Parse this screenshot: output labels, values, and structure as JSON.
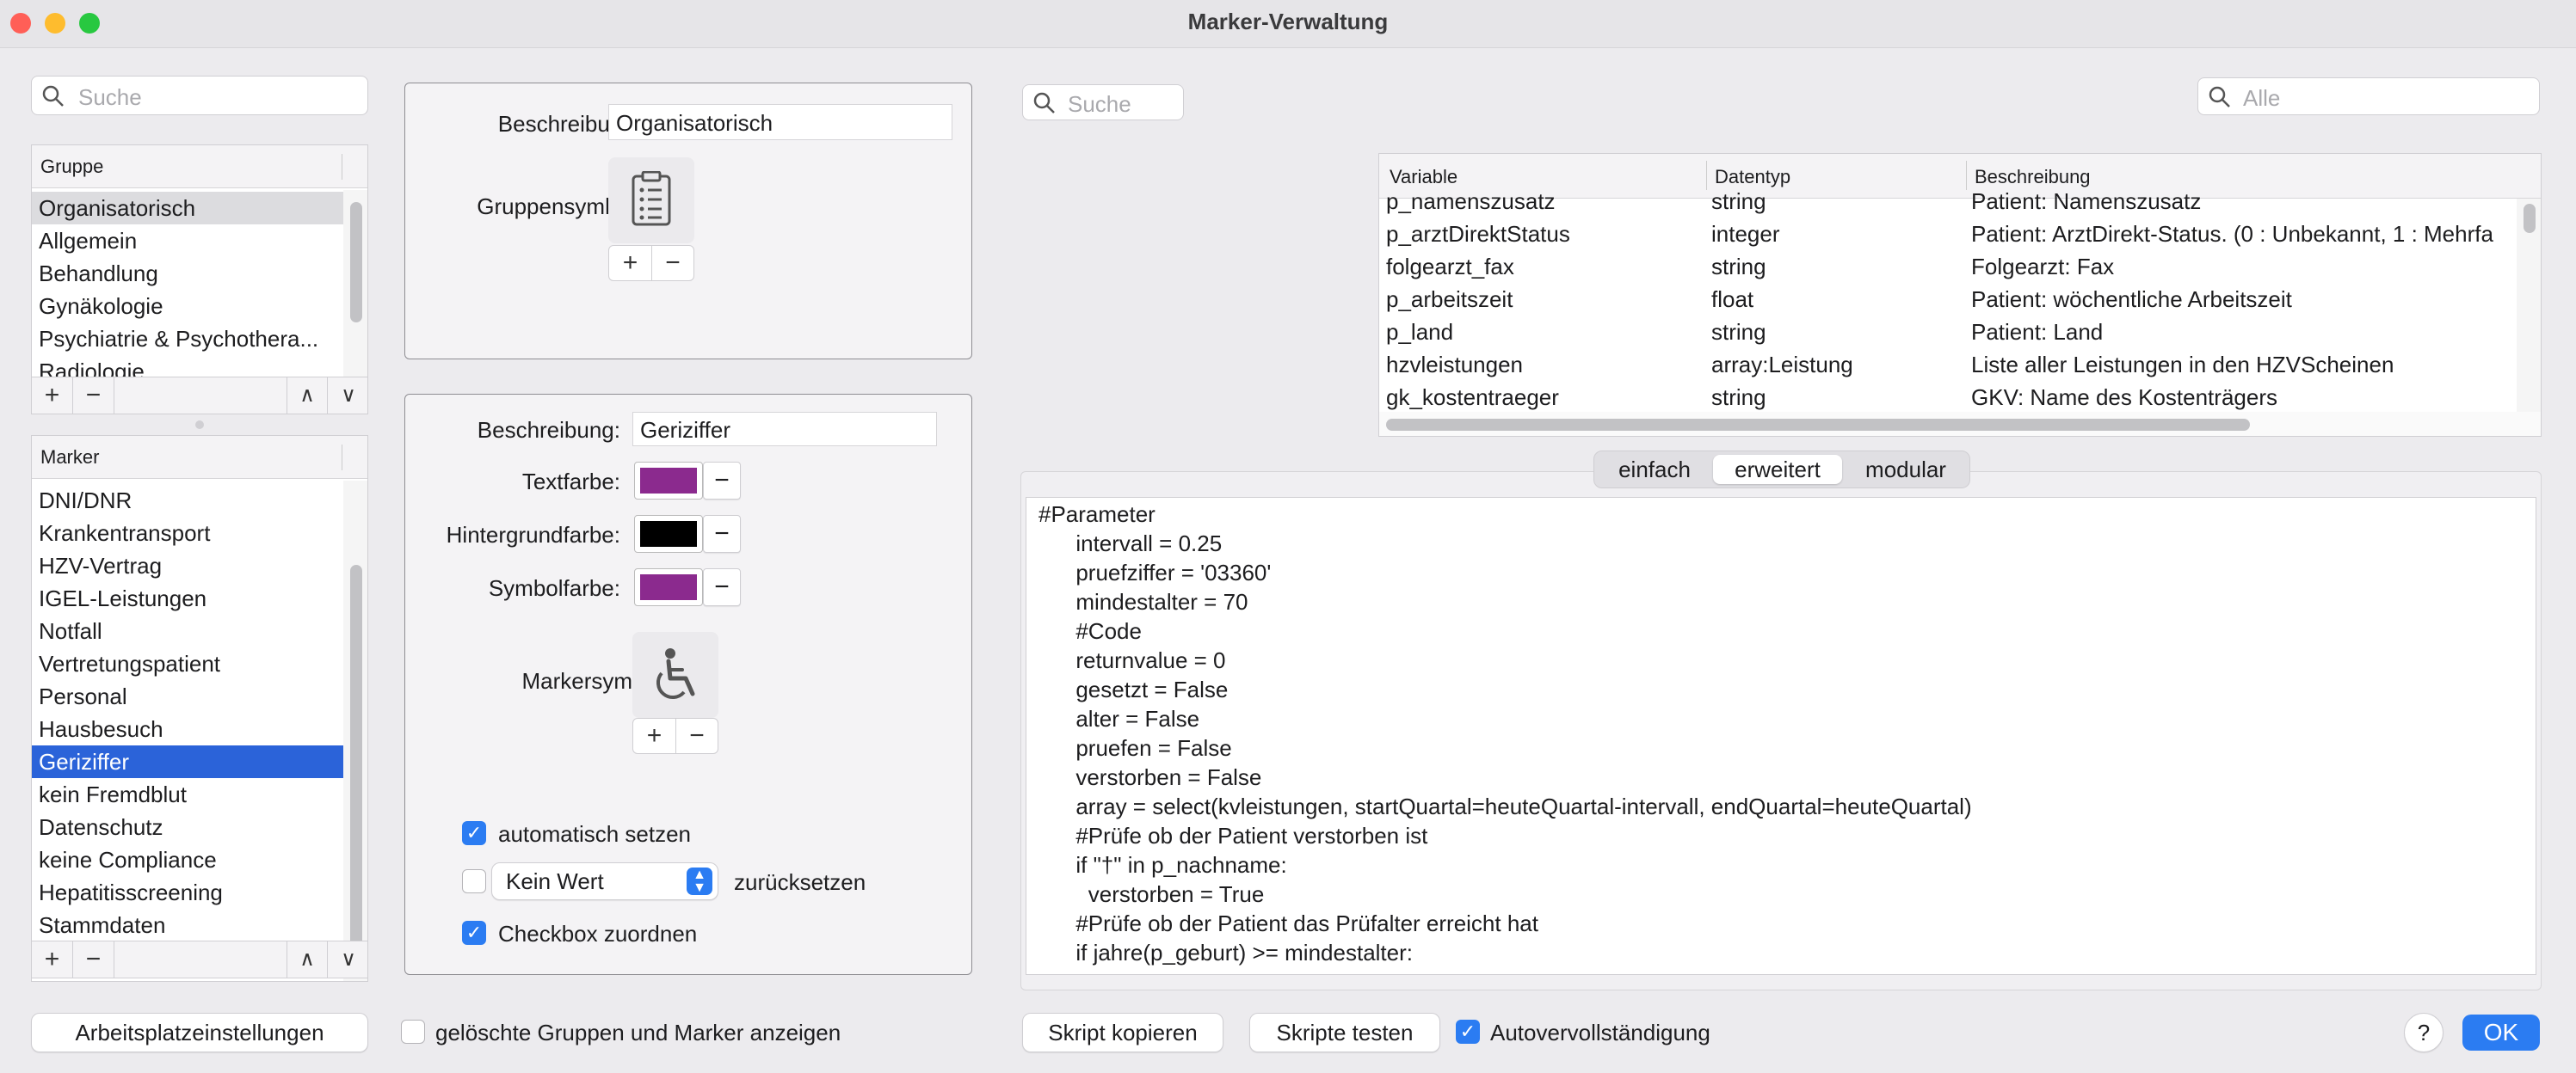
{
  "window": {
    "title": "Marker-Verwaltung"
  },
  "colors": {
    "accent": "#2b7cf2",
    "selection": "#2b63d9",
    "purple": "#8b2a8e",
    "black": "#000000"
  },
  "left": {
    "search_placeholder": "Suche",
    "groups_header": "Gruppe",
    "groups": [
      "Organisatorisch",
      "Allgemein",
      "Behandlung",
      "Gynäkologie",
      "Psychiatrie & Psychothera...",
      "Radiologie"
    ],
    "marker_header": "Marker",
    "markers": [
      "DNI/DNR",
      "Krankentransport",
      "HZV-Vertrag",
      "IGEL-Leistungen",
      "Notfall",
      "Vertretungspatient",
      "Personal",
      "Hausbesuch",
      "Geriziffer",
      "kein Fremdblut",
      "Datenschutz",
      "keine Compliance",
      "Hepatitisscreening",
      "Stammdaten"
    ],
    "selected_marker": "Geriziffer"
  },
  "group_panel": {
    "desc_label": "Beschreibung:",
    "desc_value": "Organisatorisch",
    "symbol_label": "Gruppensymbol:",
    "symbol_icon": "clipboard-list-icon"
  },
  "marker_panel": {
    "desc_label": "Beschreibung:",
    "desc_value": "Geriziffer",
    "textcolor_label": "Textfarbe:",
    "bgcolor_label": "Hintergrundfarbe:",
    "symbolcolor_label": "Symbolfarbe:",
    "markersymbol_label": "Markersymbol:",
    "symbol_icon": "wheelchair-icon",
    "auto_set_label": "automatisch setzen",
    "reset_select_value": "Kein Wert",
    "reset_label": "zurücksetzen",
    "checkbox_assign_label": "Checkbox zuordnen"
  },
  "right": {
    "search_placeholder": "Suche",
    "filter_placeholder": "Alle",
    "columns": [
      "Variable",
      "Datentyp",
      "Beschreibung"
    ],
    "rows": [
      [
        "p_namenszusatz",
        "string",
        "Patient: Namenszusatz"
      ],
      [
        "p_arztDirektStatus",
        "integer",
        "Patient: ArztDirekt-Status. (0 : Unbekannt, 1 : Mehrfa"
      ],
      [
        "folgearzt_fax",
        "string",
        "Folgearzt: Fax"
      ],
      [
        "p_arbeitszeit",
        "float",
        "Patient: wöchentliche Arbeitszeit"
      ],
      [
        "p_land",
        "string",
        "Patient: Land"
      ],
      [
        "hzvleistungen",
        "array:Leistung",
        "Liste aller Leistungen in den HZVScheinen"
      ],
      [
        "gk_kostentraeger",
        "string",
        "GKV: Name des Kostenträgers"
      ]
    ],
    "tabs": [
      "einfach",
      "erweitert",
      "modular"
    ],
    "active_tab": "erweitert",
    "code": [
      "#Parameter",
      "      intervall = 0.25",
      "      pruefziffer = '03360'",
      "      mindestalter = 70",
      "      #Code",
      "      returnvalue = 0",
      "      gesetzt = False",
      "      alter = False",
      "      pruefen = False",
      "      verstorben = False",
      "      array = select(kvleistungen, startQuartal=heuteQuartal-intervall, endQuartal=heuteQuartal)",
      "      #Prüfe ob der Patient verstorben ist",
      "      if \"†\" in p_nachname:",
      "        verstorben = True",
      "      #Prüfe ob der Patient das Prüfalter erreicht hat",
      "      if jahre(p_geburt) >= mindestalter:"
    ]
  },
  "footer": {
    "workplace_button": "Arbeitsplatzeinstellungen",
    "show_deleted_label": "gelöschte Gruppen und Marker anzeigen",
    "copy_script_button": "Skript kopieren",
    "test_scripts_button": "Skripte testen",
    "autocomplete_label": "Autovervollständigung",
    "help_button": "?",
    "ok_button": "OK"
  }
}
